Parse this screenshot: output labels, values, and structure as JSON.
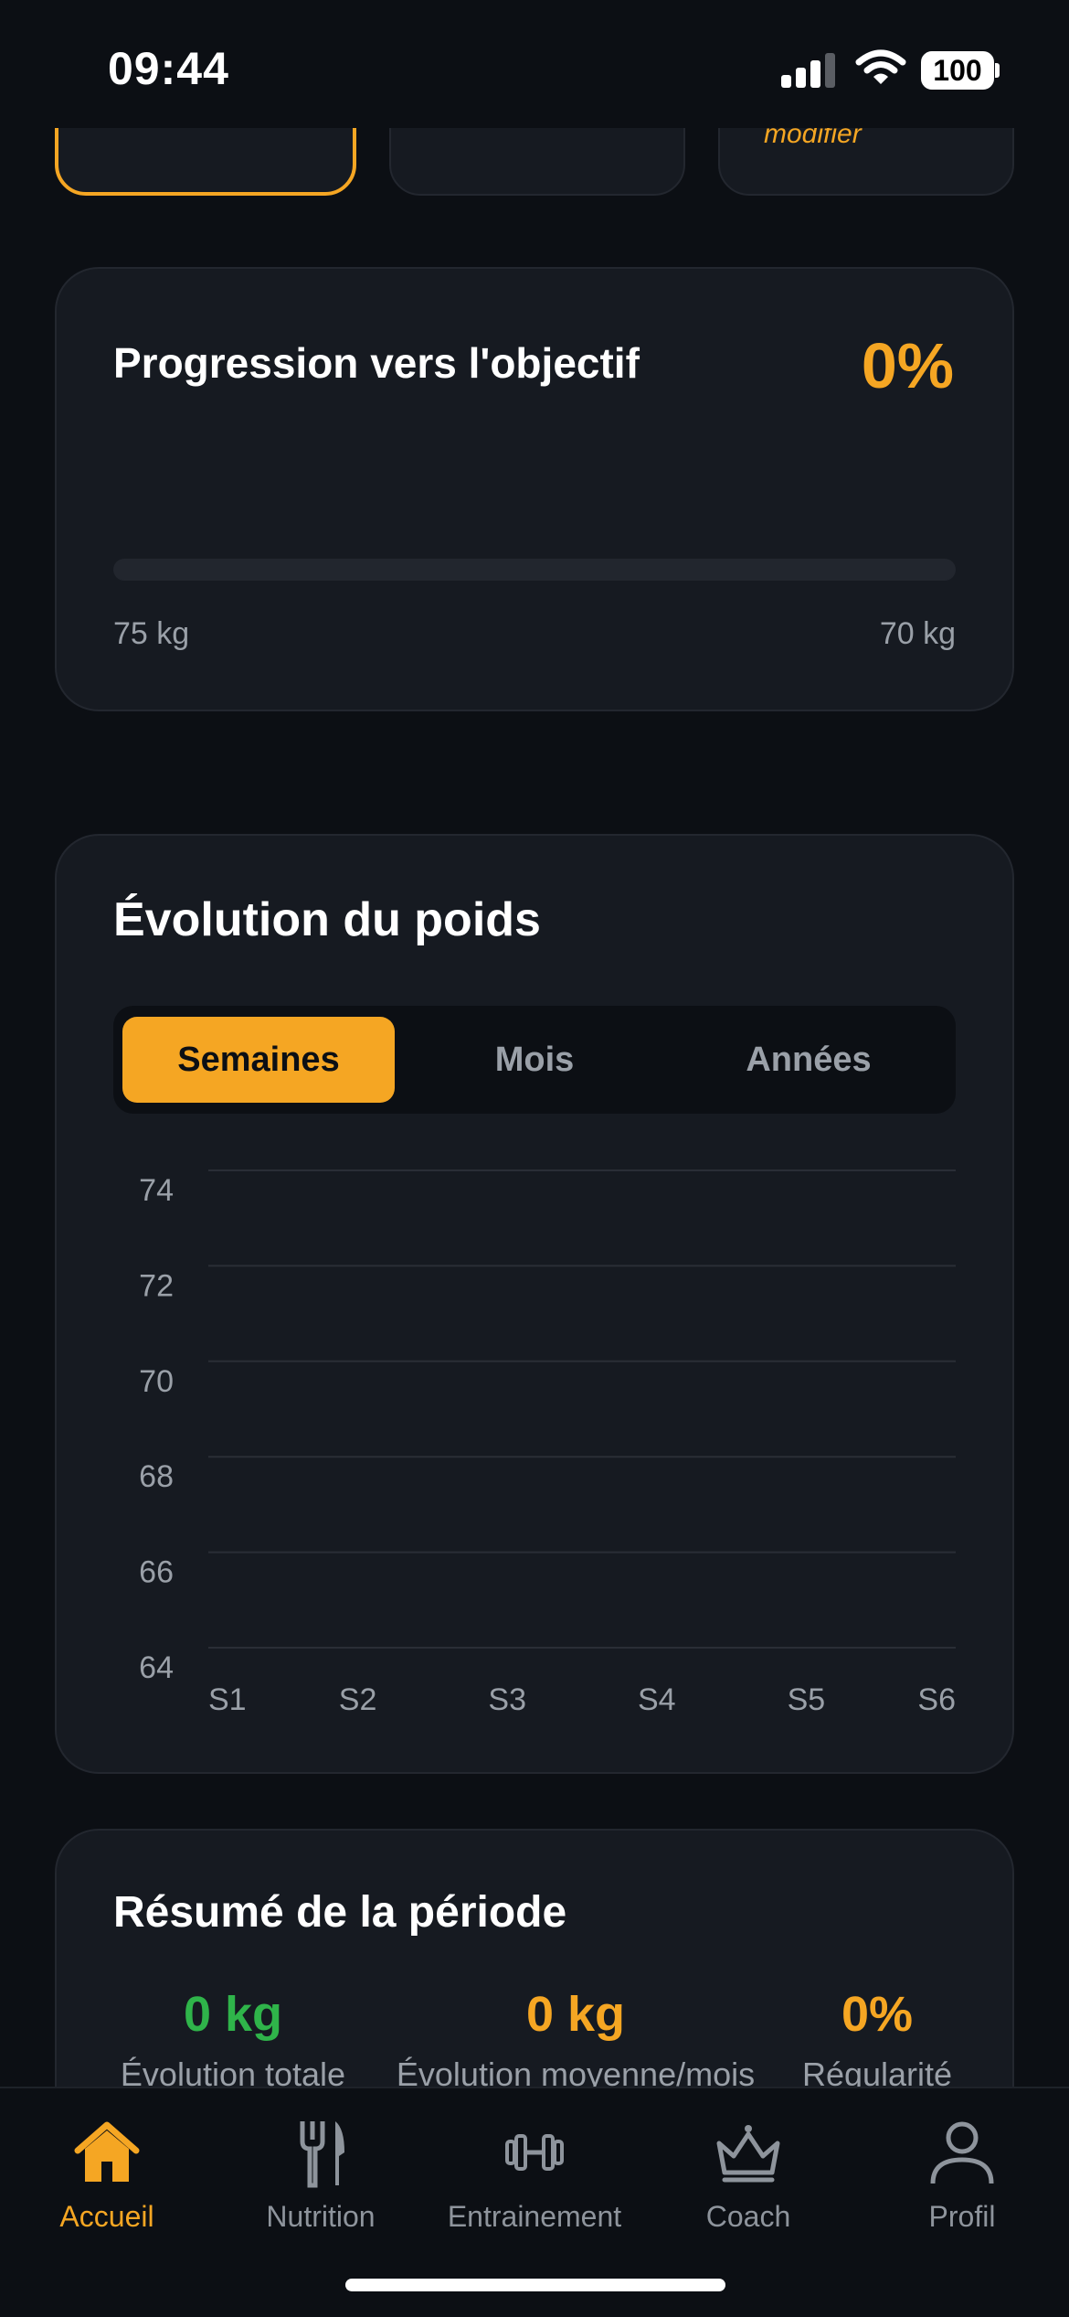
{
  "status_bar": {
    "time": "09:44",
    "battery": "100"
  },
  "top_cards": {
    "third_hint": "modifier"
  },
  "progress": {
    "title": "Progression vers l'objectif",
    "percent_label": "0%",
    "percent_value": 0,
    "start_weight": "75 kg",
    "target_weight": "70 kg"
  },
  "weight_chart": {
    "title": "Évolution du poids",
    "tabs": [
      "Semaines",
      "Mois",
      "Années"
    ],
    "active_tab": "Semaines"
  },
  "chart_data": {
    "type": "line",
    "title": "Évolution du poids",
    "categories": [
      "S1",
      "S2",
      "S3",
      "S4",
      "S5",
      "S6"
    ],
    "y_ticks": [
      "74",
      "72",
      "70",
      "68",
      "66",
      "64"
    ],
    "ylim": [
      64,
      74
    ],
    "series": [],
    "grid": true
  },
  "summary": {
    "title": "Résumé de la période",
    "stats": [
      {
        "value": "0 kg",
        "label": "Évolution totale",
        "color": "#2fb44a"
      },
      {
        "value": "0 kg",
        "label": "Évolution moyenne/mois",
        "color": "#f5a623"
      },
      {
        "value": "0%",
        "label": "Régularité",
        "color": "#f5a623"
      }
    ]
  },
  "tab_bar": {
    "items": [
      {
        "label": "Accueil",
        "icon": "home-icon"
      },
      {
        "label": "Nutrition",
        "icon": "fork-knife-icon"
      },
      {
        "label": "Entrainement",
        "icon": "dumbbell-icon"
      },
      {
        "label": "Coach",
        "icon": "crown-icon"
      },
      {
        "label": "Profil",
        "icon": "user-icon"
      }
    ],
    "active": "Accueil"
  },
  "colors": {
    "accent": "#f5a623",
    "positive": "#2fb44a",
    "background": "#0c0f14",
    "card": "#161a21"
  }
}
